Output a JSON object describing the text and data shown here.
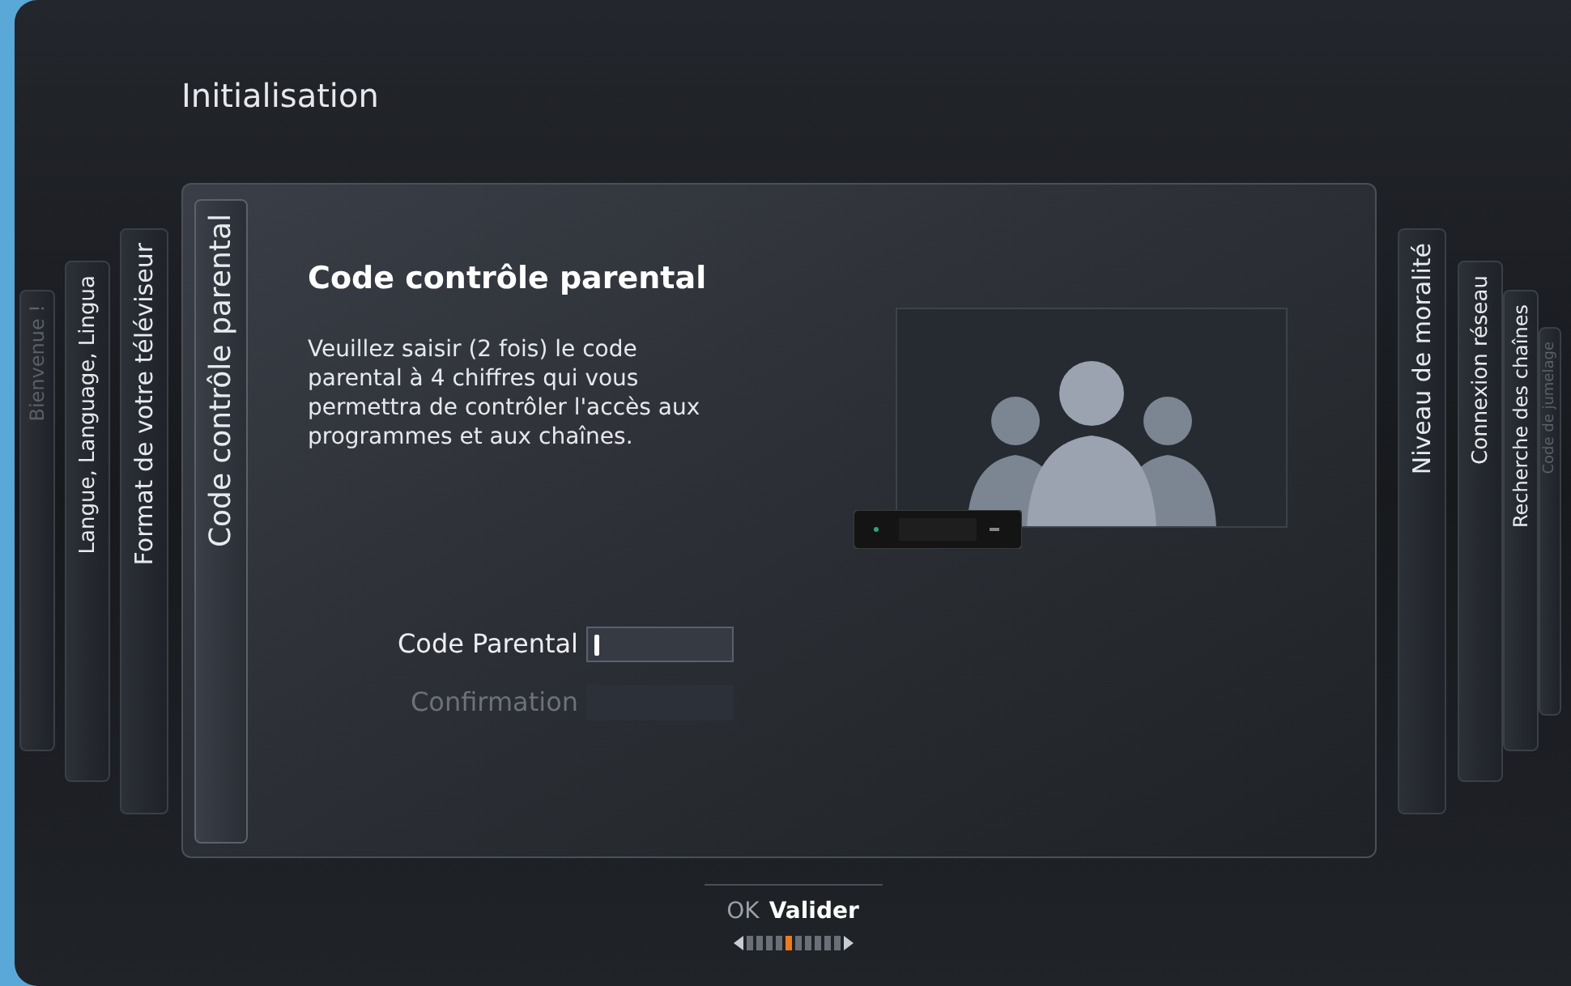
{
  "title": "Initialisation",
  "steps": [
    {
      "label": "Bienvenue !",
      "selected": false,
      "disabled": true
    },
    {
      "label": "Langue, Language, Lingua",
      "selected": false,
      "disabled": false
    },
    {
      "label": "Format de votre téléviseur",
      "selected": false,
      "disabled": false
    },
    {
      "label": "Code contrôle parental",
      "selected": true,
      "disabled": false
    },
    {
      "label": "Niveau de moralité",
      "selected": false,
      "disabled": false
    },
    {
      "label": "Connexion réseau",
      "selected": false,
      "disabled": false
    },
    {
      "label": "Recherche des chaînes",
      "selected": false,
      "disabled": false
    },
    {
      "label": "Code de jumelage",
      "selected": false,
      "disabled": true
    }
  ],
  "panel": {
    "heading": "Code contrôle parental",
    "description": "Veuillez saisir (2 fois) le code parental à 4 chiffres qui vous permettra de contrôler l'accès aux programmes et aux chaînes.",
    "fields": [
      {
        "label": "Code Parental",
        "focused": true,
        "disabled": false
      },
      {
        "label": "Confirmation",
        "focused": false,
        "disabled": true
      }
    ]
  },
  "footer": {
    "key": "OK",
    "action": "Valider",
    "pager": [
      {
        "selected": false
      },
      {
        "selected": false
      },
      {
        "selected": false
      },
      {
        "selected": false
      },
      {
        "selected": true
      },
      {
        "selected": false
      },
      {
        "selected": false
      },
      {
        "selected": false
      },
      {
        "selected": false
      },
      {
        "selected": false
      }
    ]
  }
}
